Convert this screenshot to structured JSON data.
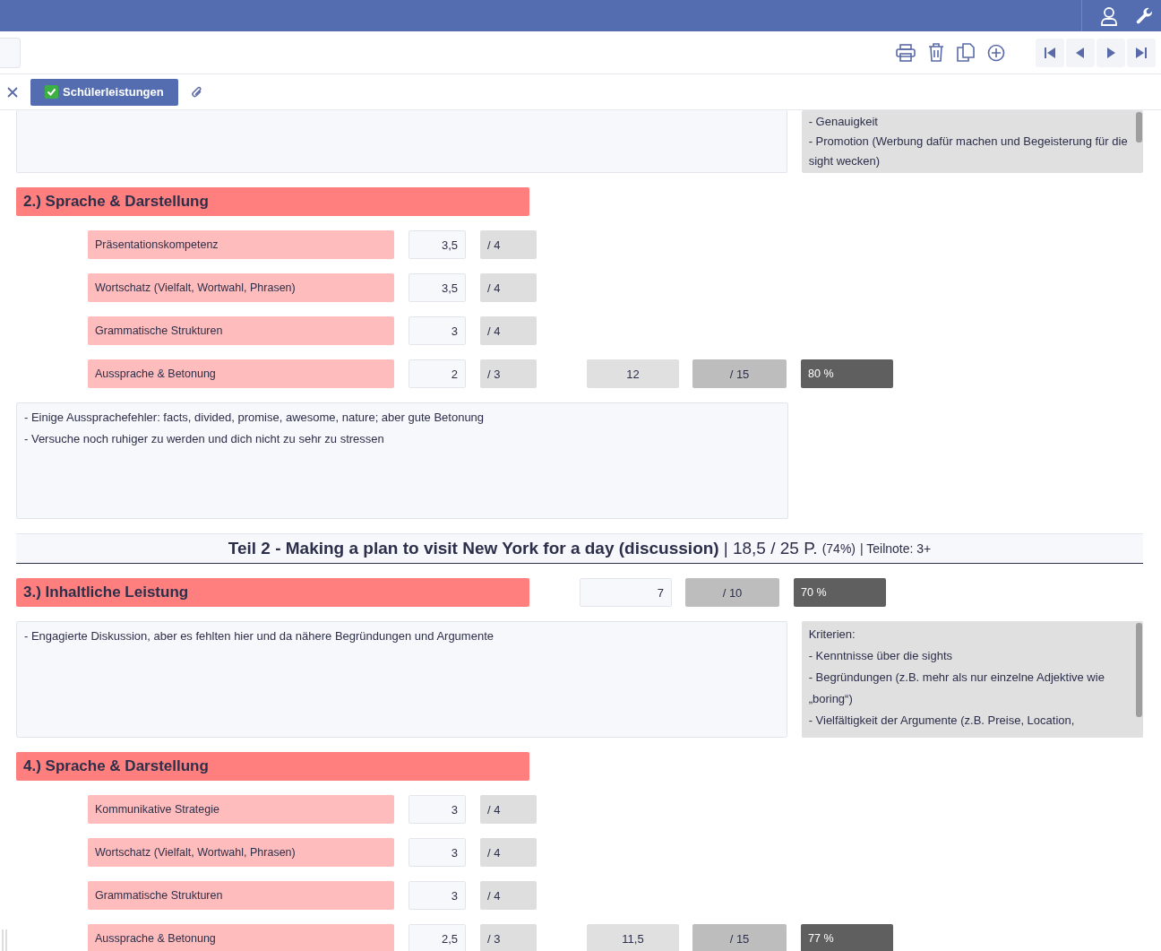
{
  "tabs": [
    {
      "label": "Schülerleistungen",
      "selected": true
    }
  ],
  "blocks": [
    {
      "kind": "notes",
      "criteria": [
        "- Genauigkeit",
        "- Promotion (Werbung dafür machen und Begeisterung für die sight wecken)"
      ]
    },
    {
      "kind": "header",
      "title": "2.) Sprache & Darstellung"
    },
    {
      "kind": "item",
      "label": "Präsentationskompetenz",
      "score": "3,5",
      "max": "/ 4"
    },
    {
      "kind": "item",
      "label": "Wortschatz (Vielfalt, Wortwahl, Phrasen)",
      "score": "3,5",
      "max": "/ 4"
    },
    {
      "kind": "item",
      "label": "Grammatische Strukturen",
      "score": "3",
      "max": "/ 4"
    },
    {
      "kind": "item",
      "label": "Aussprache & Betonung",
      "score": "2",
      "max": "/ 3",
      "total": "12",
      "total_max": "/ 15",
      "percent": "80 %"
    },
    {
      "kind": "notes",
      "comment": [
        "- Einige Aussprachefehler: facts, divided, promise, awesome, nature; aber gute Betonung",
        "- Versuche noch ruhiger zu werden und dich nicht zu sehr zu stressen"
      ]
    },
    {
      "kind": "part",
      "title": "Teil 2 - Making a plan to visit New York for a day (discussion)",
      "score": "| 18,5 / 25 P.",
      "percent": "(74%)",
      "grade": "| Teilnote: 3+"
    },
    {
      "kind": "header",
      "title": "3.) Inhaltliche Leistung",
      "total": "7",
      "total_max": "/ 10",
      "percent": "70 %"
    },
    {
      "kind": "notes",
      "comment": [
        "- Engagierte Diskussion, aber es fehlten hier und da nähere Begründungen und Argumente"
      ],
      "criteria": [
        "Kriterien:",
        "- Kenntnisse über die sights",
        "- Begründungen (z.B. mehr als nur einzelne Adjektive wie „boring“)",
        "- Vielfältigkeit der Argumente (z.B. Preise, Location,"
      ]
    },
    {
      "kind": "header",
      "title": "4.) Sprache & Darstellung"
    },
    {
      "kind": "item",
      "label": "Kommunikative Strategie",
      "score": "3",
      "max": "/ 4"
    },
    {
      "kind": "item",
      "label": "Wortschatz (Vielfalt, Wortwahl, Phrasen)",
      "score": "3",
      "max": "/ 4"
    },
    {
      "kind": "item",
      "label": "Grammatische Strukturen",
      "score": "3",
      "max": "/ 4"
    },
    {
      "kind": "item",
      "label": "Aussprache & Betonung",
      "score": "2,5",
      "max": "/ 3",
      "total": "11,5",
      "total_max": "/ 15",
      "percent": "77 %"
    }
  ]
}
